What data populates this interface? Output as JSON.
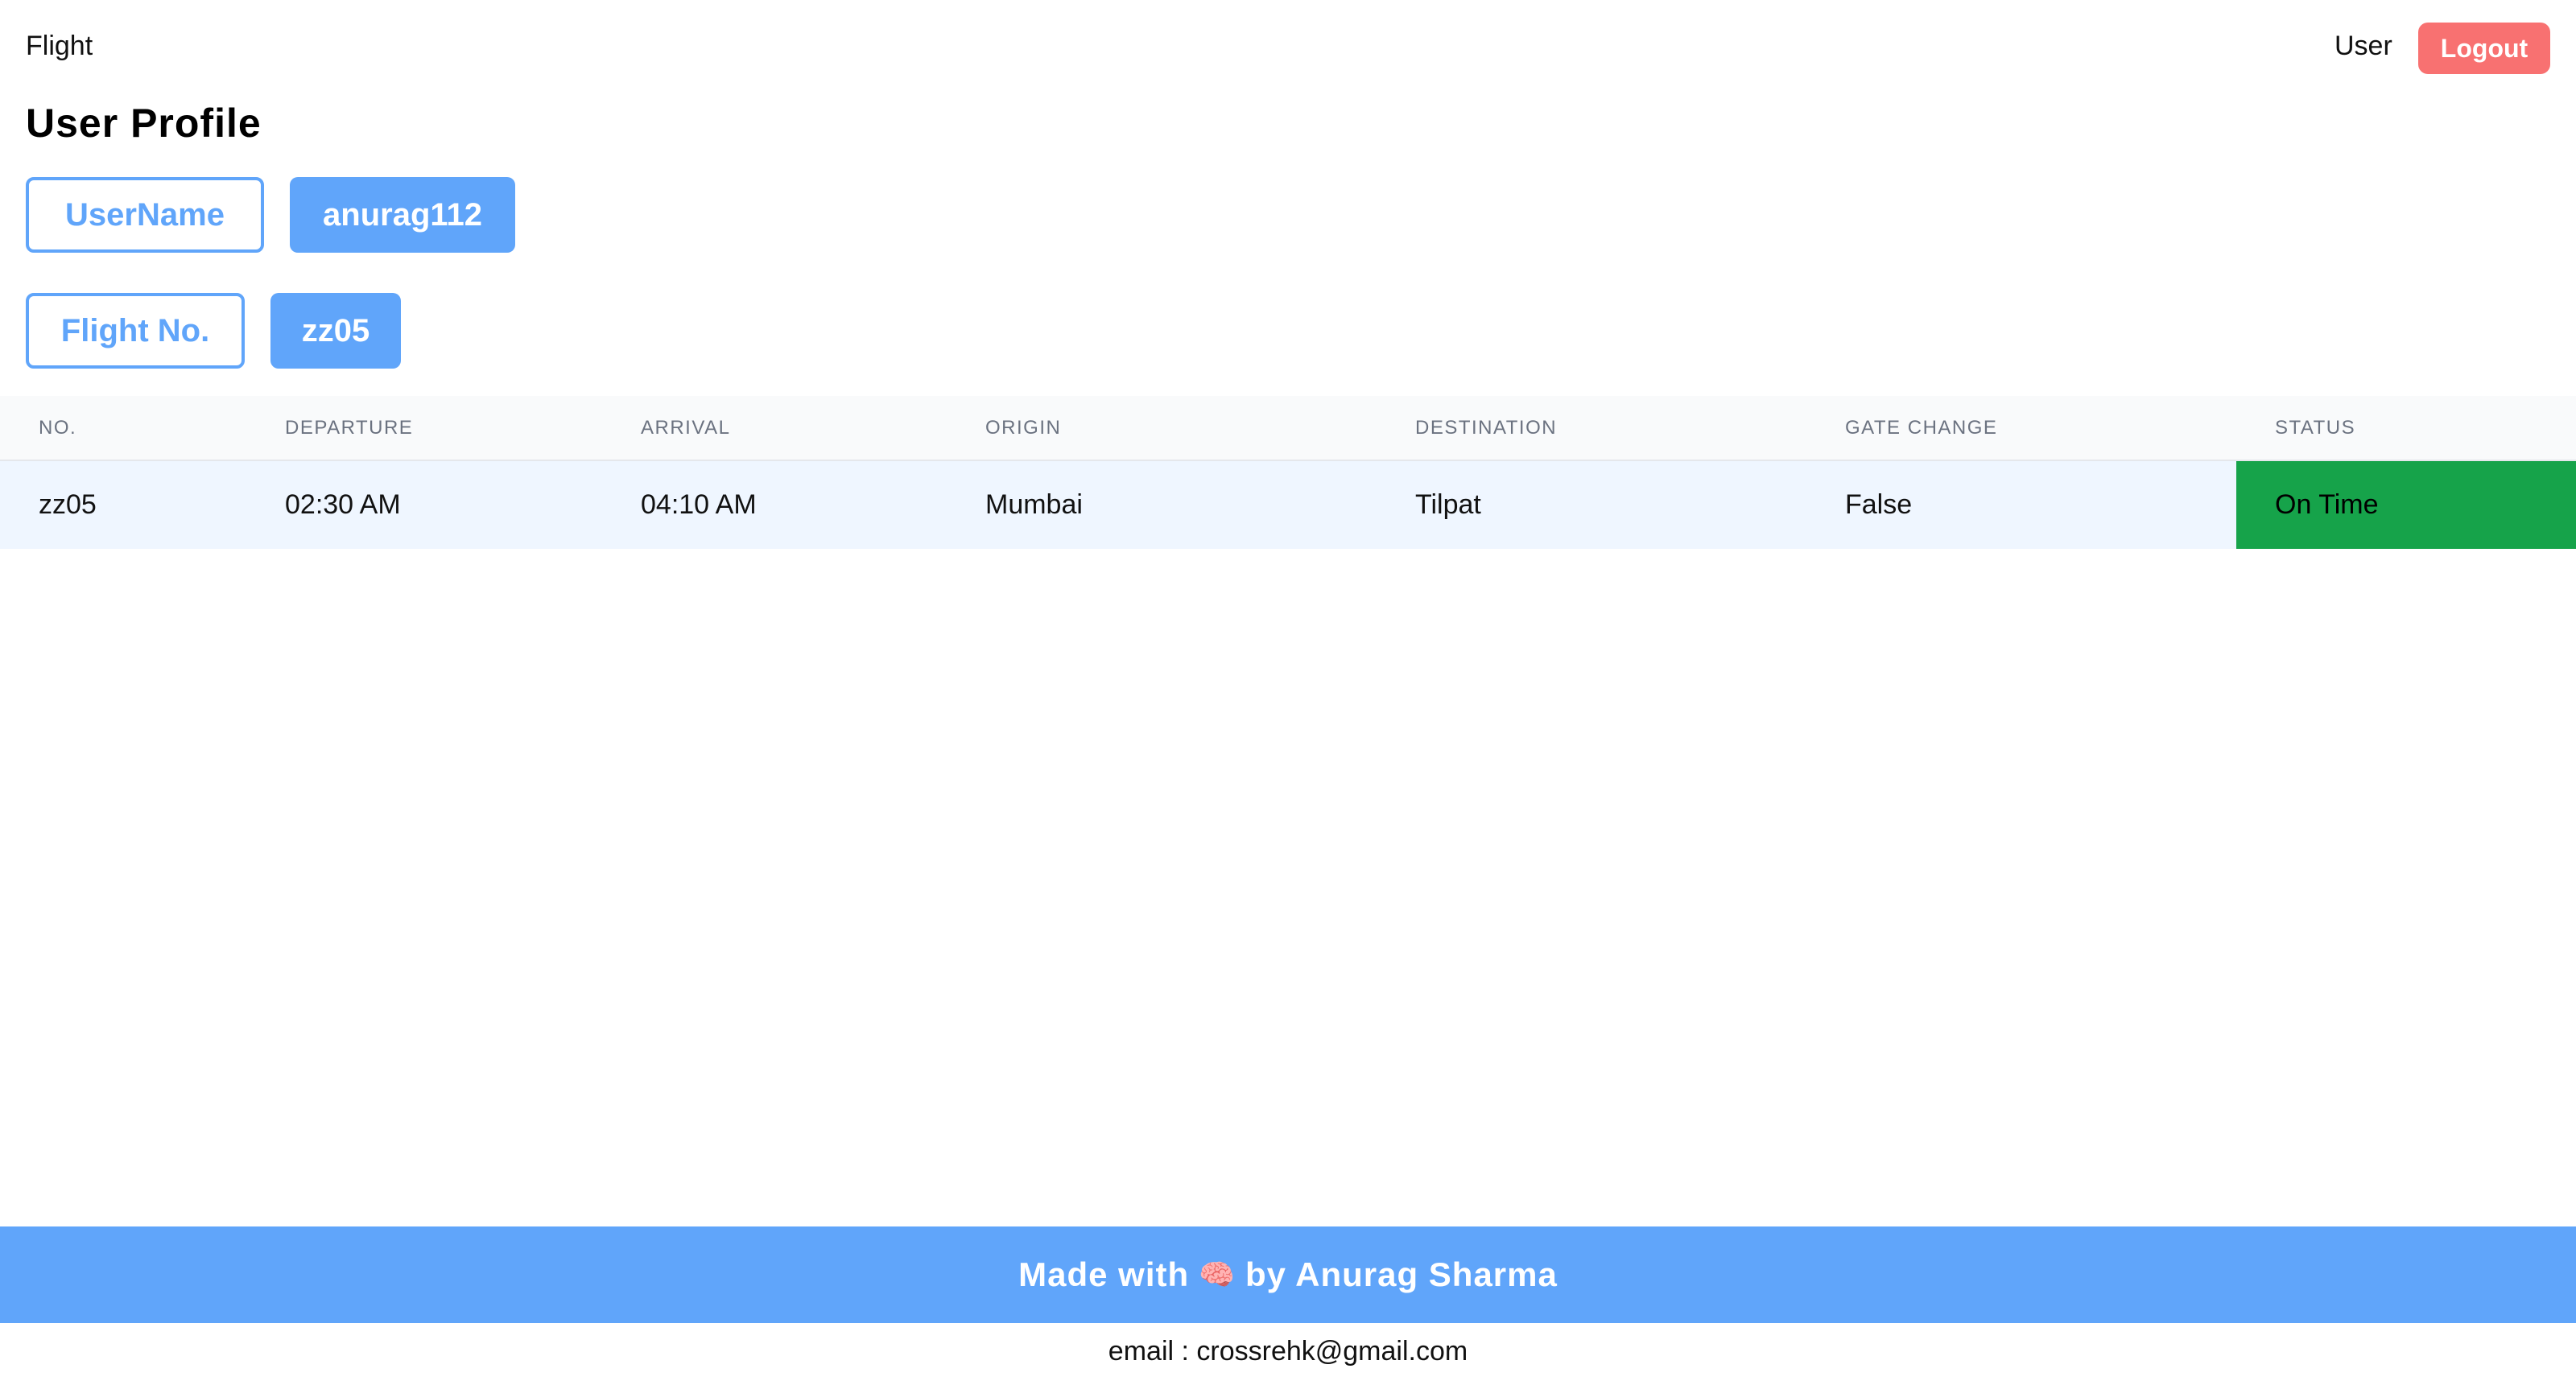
{
  "header": {
    "brand": "Flight",
    "user_label": "User",
    "logout_label": "Logout"
  },
  "page_title": "User Profile",
  "profile": {
    "username_label": "UserName",
    "username_value": "anurag112",
    "flight_label": "Flight No.",
    "flight_value": "zz05"
  },
  "table": {
    "headers": [
      "NO.",
      "DEPARTURE",
      "ARRIVAL",
      "ORIGIN",
      "DESTINATION",
      "GATE CHANGE",
      "STATUS"
    ],
    "rows": [
      [
        "zz05",
        "02:30 AM",
        "04:10 AM",
        "Mumbai",
        "Tilpat",
        "False",
        "On Time"
      ]
    ]
  },
  "footer": {
    "made_with": "Made with",
    "brain_icon": "🧠",
    "by_author": "by Anurag Sharma",
    "email": "email : crossrehk@gmail.com"
  },
  "colors": {
    "accent": "#60a5fa",
    "logout": "#f87171",
    "status_on_time": "#16a34a"
  }
}
